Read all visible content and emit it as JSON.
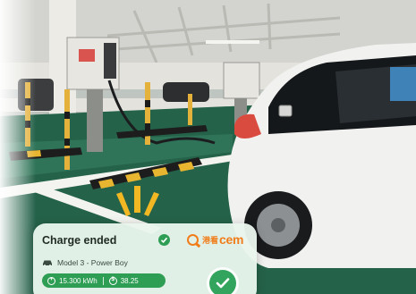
{
  "notification": {
    "title": "Charge ended",
    "vehicle": "Model 3 - Power Boy",
    "energy": "15.300 kWh",
    "cost": "38.25",
    "brand_cn": "港看",
    "brand_en": "cem"
  },
  "colors": {
    "accent_green": "#2f9e55",
    "brand_orange": "#f07d1a",
    "card_bg": "#e9f6ec",
    "floor_green": "#1f5d45"
  },
  "icons": {
    "title_status": "check-circle-icon",
    "vehicle": "car-icon",
    "energy": "plus-circle-icon",
    "cost": "dollar-circle-icon",
    "confirm": "check-circle-icon",
    "alert": "sparkle-rays-icon"
  }
}
